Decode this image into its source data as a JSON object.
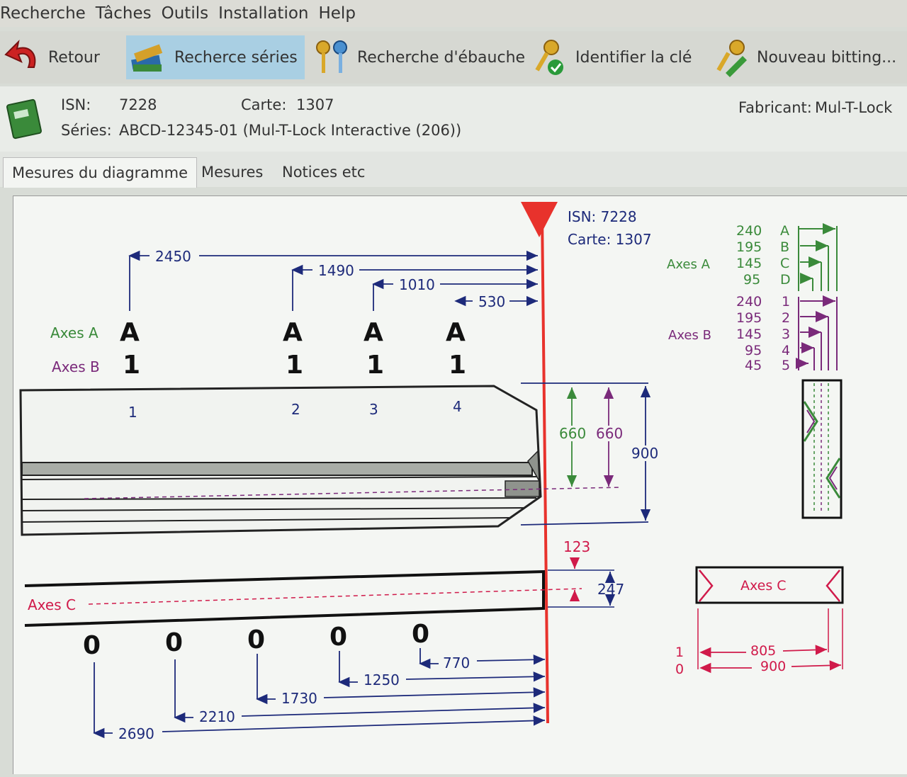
{
  "menu": [
    "Recherche",
    "Tâches",
    "Outils",
    "Installation",
    "Help"
  ],
  "toolbar": {
    "back": "Retour",
    "series_search": "Recherce séries",
    "blank_search": "Recherche d'ébauche",
    "identify_key": "Identifier la clé",
    "new_bitting": "Nouveau bitting..."
  },
  "info": {
    "isn_label": "ISN:",
    "isn_value": "7228",
    "card_label": "Carte:",
    "card_value": "1307",
    "series_label": "Séries:",
    "series_value": "ABCD-12345-01 (Mul-T-Lock Interactive (206))",
    "maker_label": "Fabricant:",
    "maker_value": "Mul-T-Lock"
  },
  "tabs": [
    "Mesures du diagramme",
    "Mesures",
    "Notices etc"
  ],
  "diagram": {
    "isn_text": "ISN: 7228",
    "card_text": "Carte: 1307",
    "axes_a_label": "Axes A",
    "axes_b_label": "Axes B",
    "axes_c_label": "Axes C",
    "top_dims": [
      "2450",
      "1490",
      "1010",
      "530"
    ],
    "a_cuts": [
      "A",
      "A",
      "A",
      "A"
    ],
    "b_cuts": [
      "1",
      "1",
      "1",
      "1"
    ],
    "positions": [
      "1",
      "2",
      "3",
      "4"
    ],
    "height_dims": [
      "660",
      "660",
      "900"
    ],
    "c_dims": [
      "123",
      "247"
    ],
    "bottom_cuts": [
      "0",
      "0",
      "0",
      "0",
      "0"
    ],
    "bottom_dims": [
      "770",
      "1250",
      "1730",
      "2210",
      "2690"
    ],
    "legend_a": [
      {
        "v": "240",
        "k": "A"
      },
      {
        "v": "195",
        "k": "B"
      },
      {
        "v": "145",
        "k": "C"
      },
      {
        "v": "95",
        "k": "D"
      }
    ],
    "legend_b": [
      {
        "v": "240",
        "k": "1"
      },
      {
        "v": "195",
        "k": "2"
      },
      {
        "v": "145",
        "k": "3"
      },
      {
        "v": "95",
        "k": "4"
      },
      {
        "v": "45",
        "k": "5"
      }
    ],
    "legend_c": [
      {
        "k": "1",
        "v": "805"
      },
      {
        "k": "0",
        "v": "900"
      }
    ],
    "colors": {
      "navy": "#1d2a7a",
      "green": "#3a8a3a",
      "purple": "#7a2a7a",
      "crimson": "#d01a4a",
      "red": "#e8322c"
    }
  }
}
